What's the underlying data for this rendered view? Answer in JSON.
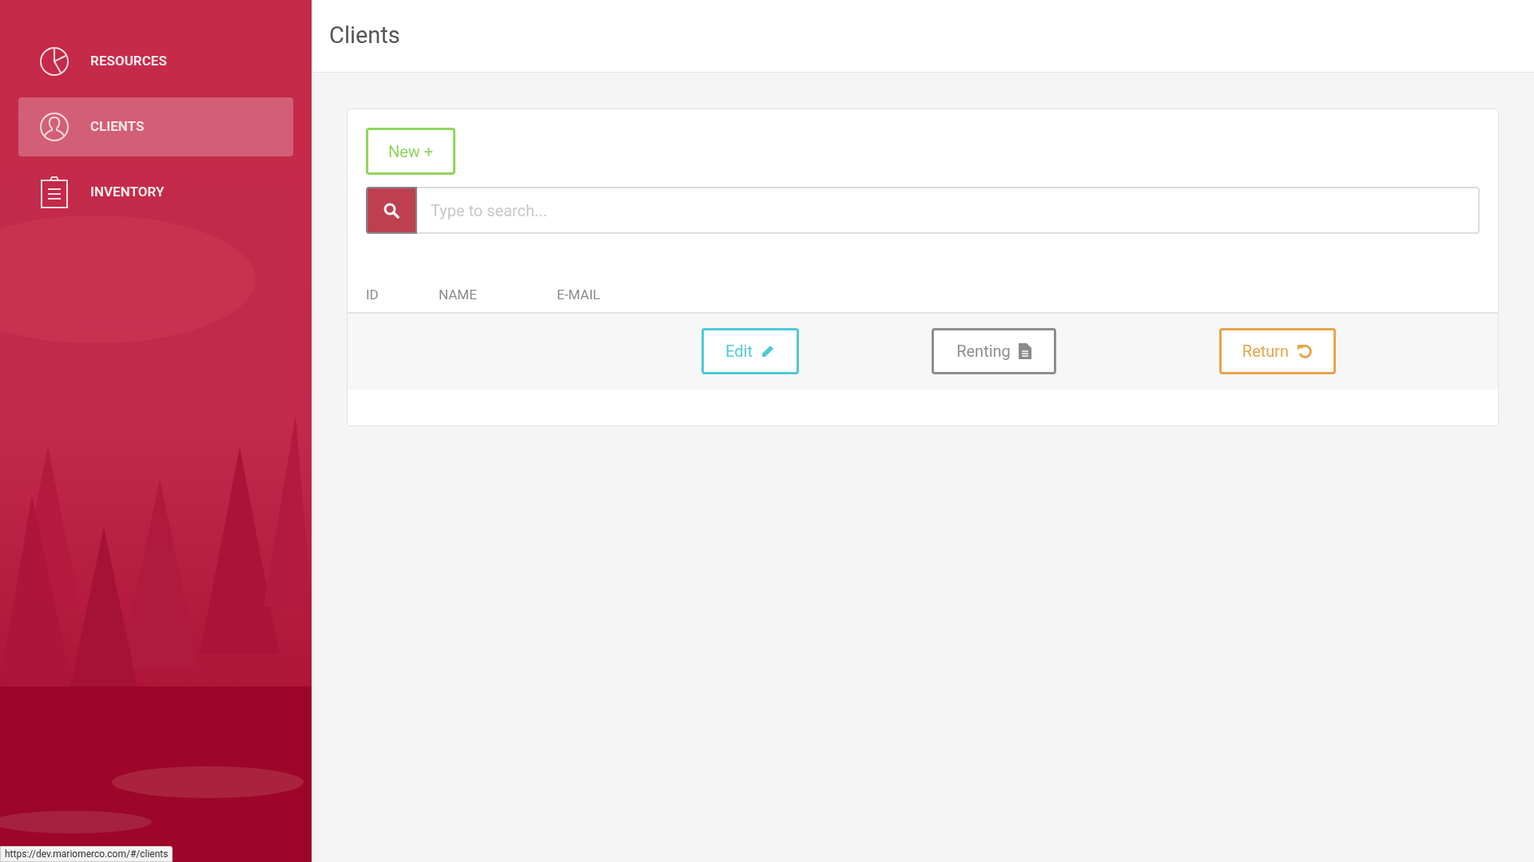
{
  "sidebar": {
    "items": [
      {
        "label": "RESOURCES",
        "kind": "chart",
        "selected": false
      },
      {
        "label": "CLIENTS",
        "kind": "user",
        "selected": true
      },
      {
        "label": "INVENTORY",
        "kind": "clipboard",
        "selected": false
      }
    ]
  },
  "header": {
    "title": "Clients"
  },
  "new_button": {
    "label": "New +"
  },
  "search": {
    "placeholder": "Type to search..."
  },
  "table": {
    "columns": [
      "ID",
      "NAME",
      "E-MAIL"
    ],
    "rows": [
      {
        "actions": [
          {
            "label": "Edit",
            "kind": "edit"
          },
          {
            "label": "Renting",
            "kind": "renting"
          },
          {
            "label": "Return",
            "kind": "return"
          }
        ]
      }
    ]
  },
  "status_url": "https://dev.mariomerco.com/#/clients"
}
